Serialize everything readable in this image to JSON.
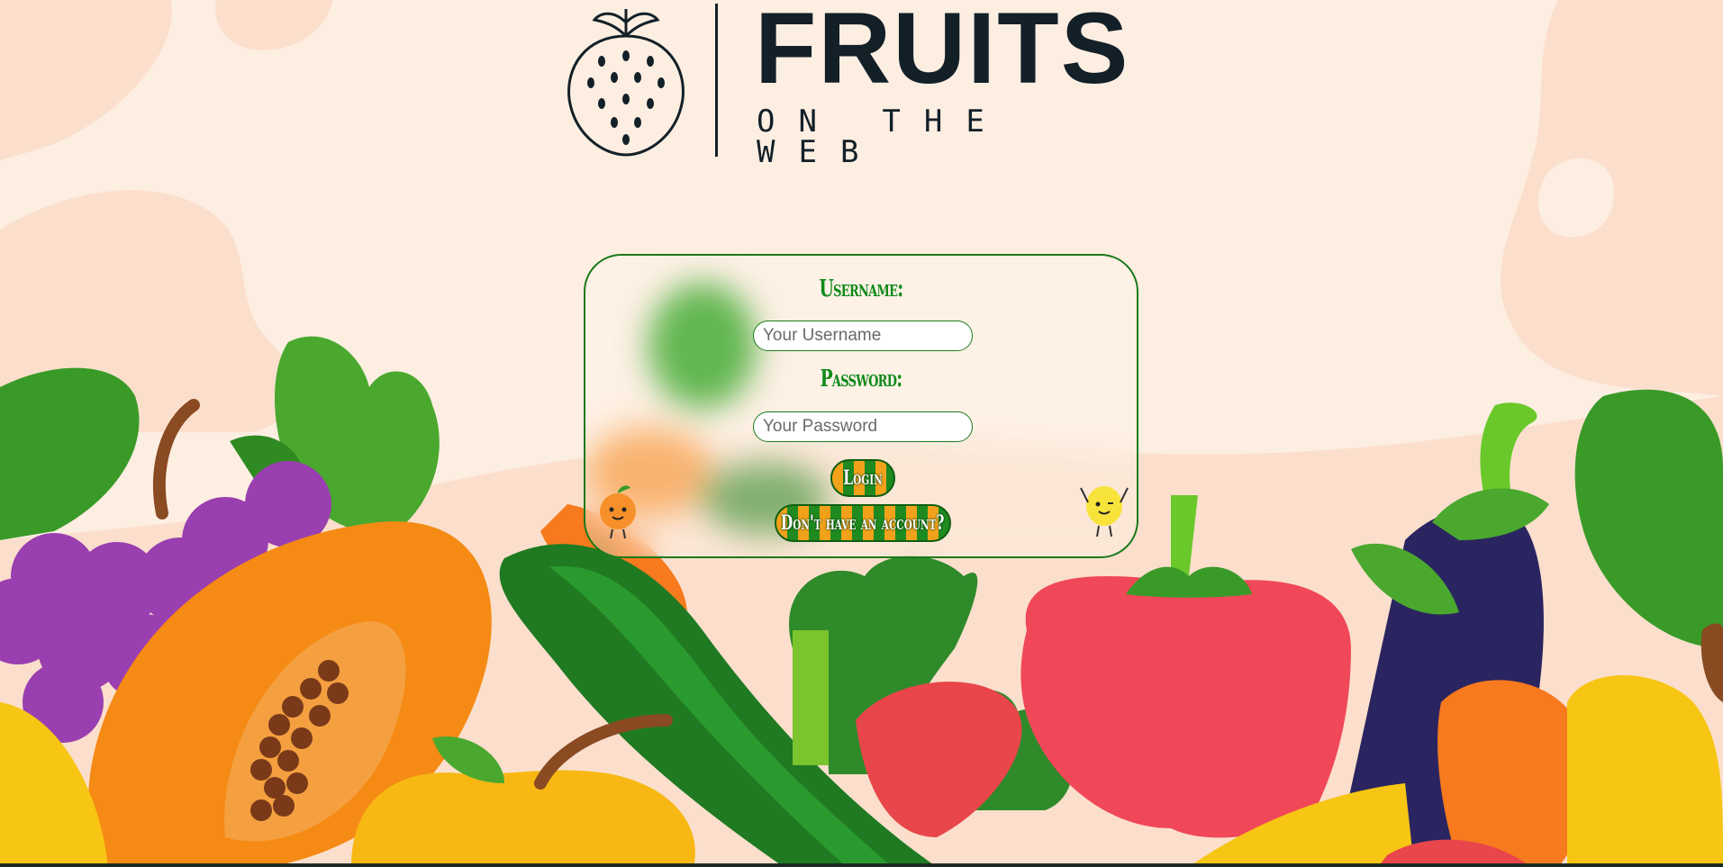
{
  "logo": {
    "title": "FRUITS",
    "subtitle": "ON THE WEB",
    "icon": "strawberry-icon"
  },
  "login": {
    "username_label": "Username:",
    "username_placeholder": "Your Username",
    "username_value": "",
    "password_label": "Password:",
    "password_placeholder": "Your Password",
    "password_value": "",
    "login_button": "Login",
    "signup_button": "Don't have an account?",
    "left_mascot": "orange-mascot-icon",
    "right_mascot": "lemon-mascot-icon"
  },
  "colors": {
    "background": "#fdeee2",
    "accent_green": "#0f8a1a",
    "button_orange": "#f2a21a",
    "logo_dark": "#132028"
  }
}
